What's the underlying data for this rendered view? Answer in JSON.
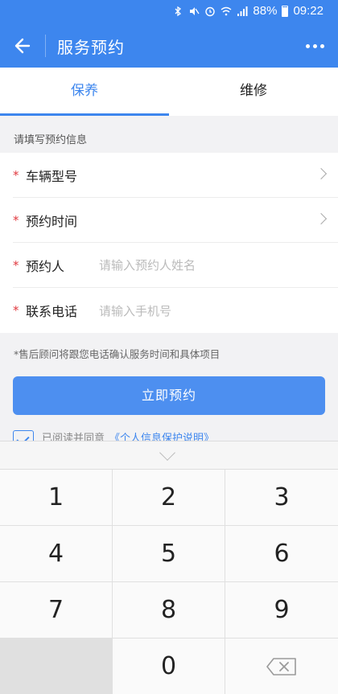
{
  "status_bar": {
    "battery": "88%",
    "time": "09:22"
  },
  "appbar": {
    "title": "服务预约",
    "back_icon": "arrow-left-icon",
    "more_icon": "more-dots-icon"
  },
  "tabs": [
    {
      "label": "保养",
      "active": true
    },
    {
      "label": "维修",
      "active": false
    }
  ],
  "section_title": "请填写预约信息",
  "form": {
    "rows": [
      {
        "required": "*",
        "label": "车辆型号",
        "placeholder": "",
        "has_arrow": true
      },
      {
        "required": "*",
        "label": "预约时间",
        "placeholder": "",
        "has_arrow": true
      },
      {
        "required": "*",
        "label": "预约人",
        "placeholder": "请输入预约人姓名",
        "has_arrow": false
      },
      {
        "required": "*",
        "label": "联系电话",
        "placeholder": "请输入手机号",
        "has_arrow": false
      }
    ]
  },
  "notice": "*售后顾问将跟您电话确认服务时间和具体项目",
  "submit_label": "立即预约",
  "agreement": {
    "text": "已阅读并同意",
    "link": "《个人信息保护说明》",
    "checked": true
  },
  "keyboard": {
    "keys": [
      "1",
      "2",
      "3",
      "4",
      "5",
      "6",
      "7",
      "8",
      "9",
      "",
      "0",
      "backspace"
    ]
  },
  "colors": {
    "primary": "#3d86ee",
    "required": "#e0383e"
  }
}
